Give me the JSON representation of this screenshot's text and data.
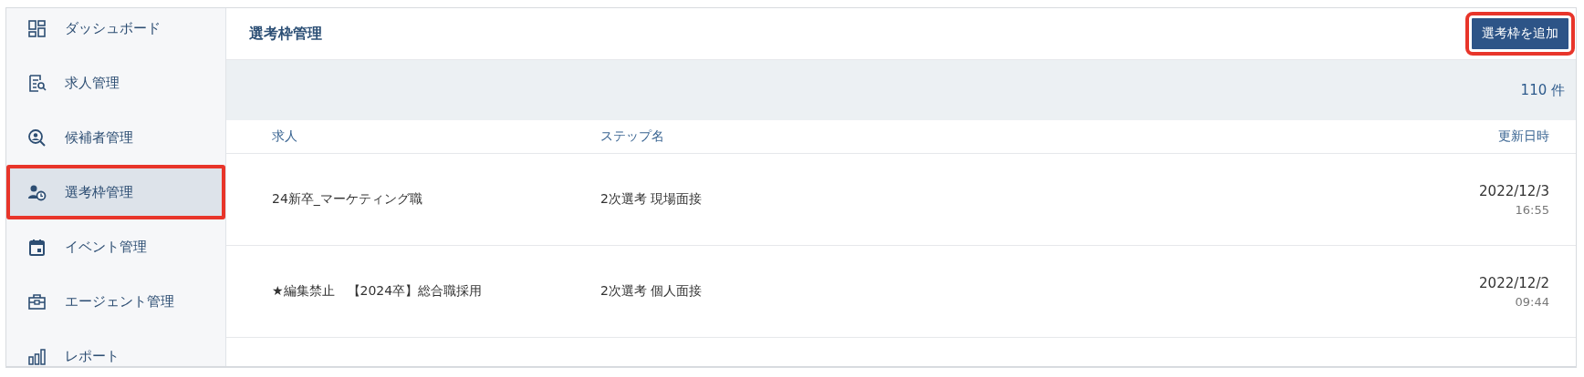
{
  "sidebar": {
    "items": [
      {
        "label": "ダッシュボード",
        "selected": false,
        "annotated": false
      },
      {
        "label": "求人管理",
        "selected": false,
        "annotated": false
      },
      {
        "label": "候補者管理",
        "selected": false,
        "annotated": false
      },
      {
        "label": "選考枠管理",
        "selected": true,
        "annotated": true
      },
      {
        "label": "イベント管理",
        "selected": false,
        "annotated": false
      },
      {
        "label": "エージェント管理",
        "selected": false,
        "annotated": false
      },
      {
        "label": "レポート",
        "selected": false,
        "annotated": false
      }
    ]
  },
  "header": {
    "title": "選考枠管理",
    "button": {
      "label": "選考枠を追加",
      "annotated": true
    }
  },
  "summary": {
    "count": "110 件"
  },
  "table": {
    "columns": [
      "求人",
      "ステップ名",
      "更新日時"
    ],
    "rows": [
      {
        "job": "24新卒_マーケティング職",
        "step": "2次選考 現場面接",
        "date": "2022/12/3",
        "time": "16:55"
      },
      {
        "job": "★編集禁止　【2024卒】総合職採用",
        "step": "2次選考 個人面接",
        "date": "2022/12/2",
        "time": "09:44"
      }
    ]
  }
}
